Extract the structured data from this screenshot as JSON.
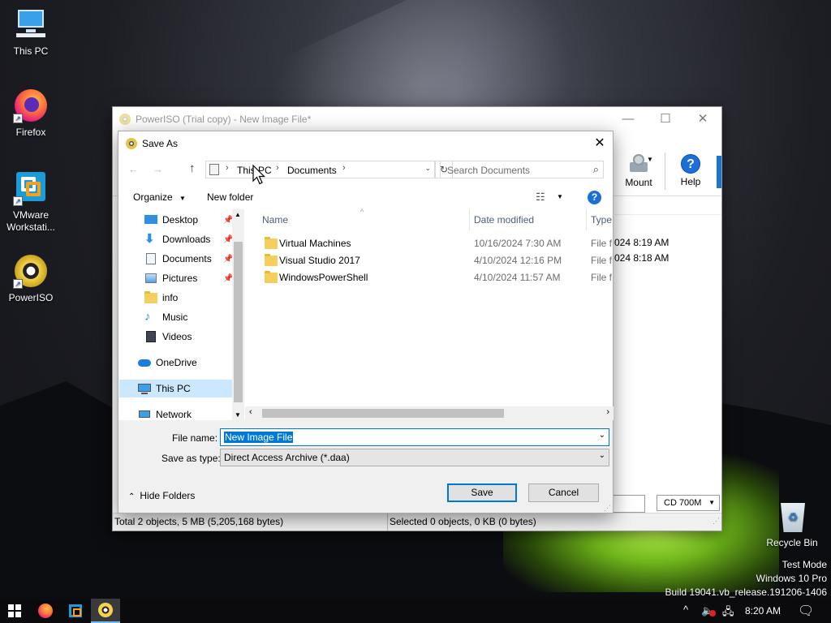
{
  "desktop": {
    "icons": [
      {
        "label": "This PC"
      },
      {
        "label": "Firefox"
      },
      {
        "label": "VMware Workstati..."
      },
      {
        "label": "PowerISO"
      },
      {
        "label": "Recycle Bin"
      }
    ],
    "watermark": {
      "line1": "Test Mode",
      "line2": "Windows 10 Pro",
      "line3": "Build 19041.vb_release.191206-1406"
    }
  },
  "main_window": {
    "title": "PowerISO (Trial copy) - New Image File*",
    "toolbar": {
      "mount_label": "Mount",
      "help_label": "Help"
    },
    "bg_times": [
      "024 8:19 AM",
      "024 8:18 AM"
    ],
    "disc_size": "CD 700M",
    "status_left": "Total 2 objects, 5 MB (5,205,168 bytes)",
    "status_right": "Selected 0 objects, 0 KB (0 bytes)"
  },
  "dialog": {
    "title": "Save As",
    "breadcrumb": [
      "This PC",
      "Documents"
    ],
    "search_placeholder": "Search Documents",
    "organize_label": "Organize",
    "new_folder_label": "New folder",
    "nav_items": [
      {
        "label": "Desktop",
        "icon": "desktop-icon",
        "pinned": true
      },
      {
        "label": "Downloads",
        "icon": "download-icon",
        "pinned": true
      },
      {
        "label": "Documents",
        "icon": "document-icon",
        "pinned": true
      },
      {
        "label": "Pictures",
        "icon": "picture-icon",
        "pinned": true
      },
      {
        "label": "info",
        "icon": "folder-icon",
        "pinned": false
      },
      {
        "label": "Music",
        "icon": "music-icon",
        "pinned": false
      },
      {
        "label": "Videos",
        "icon": "video-icon",
        "pinned": false
      },
      {
        "label": "OneDrive",
        "icon": "cloud-icon",
        "pinned": false
      },
      {
        "label": "This PC",
        "icon": "computer-icon",
        "pinned": false,
        "selected": true
      },
      {
        "label": "Network",
        "icon": "network-icon",
        "pinned": false
      }
    ],
    "columns": {
      "name": "Name",
      "date": "Date modified",
      "type": "Type"
    },
    "files": [
      {
        "name": "Virtual Machines",
        "date": "10/16/2024 7:30 AM",
        "type": "File f"
      },
      {
        "name": "Visual Studio 2017",
        "date": "4/10/2024 12:16 PM",
        "type": "File f"
      },
      {
        "name": "WindowsPowerShell",
        "date": "4/10/2024 11:57 AM",
        "type": "File f"
      }
    ],
    "file_name_label": "File name:",
    "file_name_value": "New Image File",
    "save_type_label": "Save as type:",
    "save_type_value": "Direct Access Archive (*.daa)",
    "hide_folders_label": "Hide Folders",
    "save_label": "Save",
    "cancel_label": "Cancel"
  },
  "taskbar": {
    "clock": "8:20 AM"
  },
  "colors": {
    "accent": "#0078d7",
    "selection": "#cce8ff",
    "folder": "#f5cf5d"
  }
}
